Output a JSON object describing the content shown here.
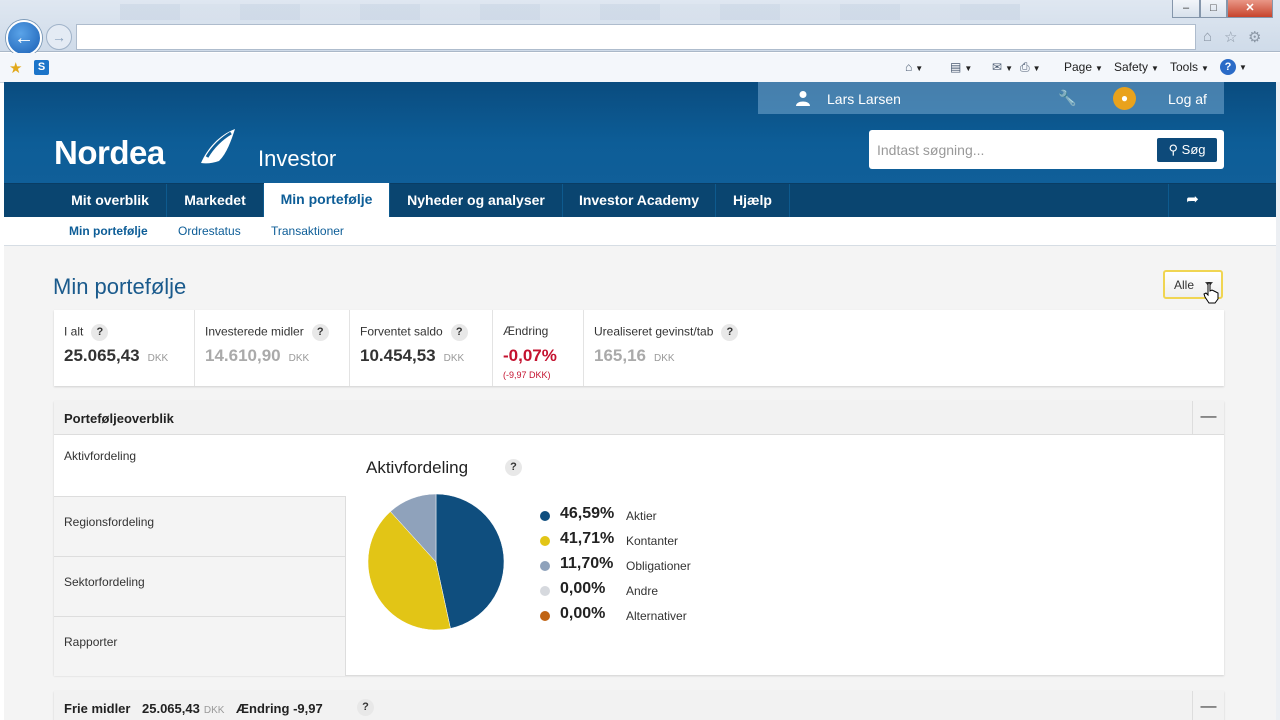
{
  "header": {
    "user_name": "Lars Larsen",
    "logout_label": "Log af",
    "logo_text": "Nordea",
    "app_name": "Investor",
    "search_placeholder": "Indtast søgning...",
    "search_button": "Søg"
  },
  "browser": {
    "page_menu": "Page",
    "safety_menu": "Safety",
    "tools_menu": "Tools",
    "help_symbol": "?"
  },
  "main_nav": [
    {
      "label": "Mit overblik"
    },
    {
      "label": "Markedet"
    },
    {
      "label": "Min portefølje",
      "active": true
    },
    {
      "label": "Nyheder og analyser"
    },
    {
      "label": "Investor Academy"
    },
    {
      "label": "Hjælp"
    }
  ],
  "sub_nav": [
    {
      "label": "Min portefølje",
      "active": true
    },
    {
      "label": "Ordrestatus"
    },
    {
      "label": "Transaktioner"
    }
  ],
  "page": {
    "title": "Min portefølje",
    "filter_label": "Alle"
  },
  "summary": {
    "total": {
      "label": "I alt",
      "value": "25.065,43",
      "currency": "DKK"
    },
    "invested": {
      "label": "Investerede midler",
      "value": "14.610,90",
      "currency": "DKK"
    },
    "expected": {
      "label": "Forventet saldo",
      "value": "10.454,53",
      "currency": "DKK"
    },
    "change": {
      "label": "Ændring",
      "value": "-0,07%",
      "sub": "(-9,97 DKK)"
    },
    "unrealized": {
      "label": "Urealiseret gevinst/tab",
      "value": "165,16",
      "currency": "DKK"
    }
  },
  "overview": {
    "title": "Porteføljeoverblik",
    "tabs": [
      "Aktivfordeling",
      "Regionsfordeling",
      "Sektorfordeling",
      "Rapporter"
    ],
    "chart_title": "Aktivfordeling",
    "legend": [
      {
        "pct": "46,59%",
        "name": "Aktier",
        "color": "#0f4e7e"
      },
      {
        "pct": "41,71%",
        "name": "Kontanter",
        "color": "#e2c516"
      },
      {
        "pct": "11,70%",
        "name": "Obligationer",
        "color": "#8fa2bb"
      },
      {
        "pct": "0,00%",
        "name": "Andre",
        "color": "#d6d9de"
      },
      {
        "pct": "0,00%",
        "name": "Alternativer",
        "color": "#c06414"
      }
    ]
  },
  "chart_data": {
    "type": "pie",
    "title": "Aktivfordeling",
    "categories": [
      "Aktier",
      "Kontanter",
      "Obligationer",
      "Andre",
      "Alternativer"
    ],
    "values": [
      46.59,
      41.71,
      11.7,
      0.0,
      0.0
    ],
    "colors": [
      "#0f4e7e",
      "#e2c516",
      "#8fa2bb",
      "#d6d9de",
      "#c06414"
    ],
    "legend": "right"
  },
  "free_funds": {
    "title": "Frie midler",
    "value": "25.065,43",
    "currency": "DKK",
    "change_label": "Ændring",
    "change_value": "-9,97"
  }
}
